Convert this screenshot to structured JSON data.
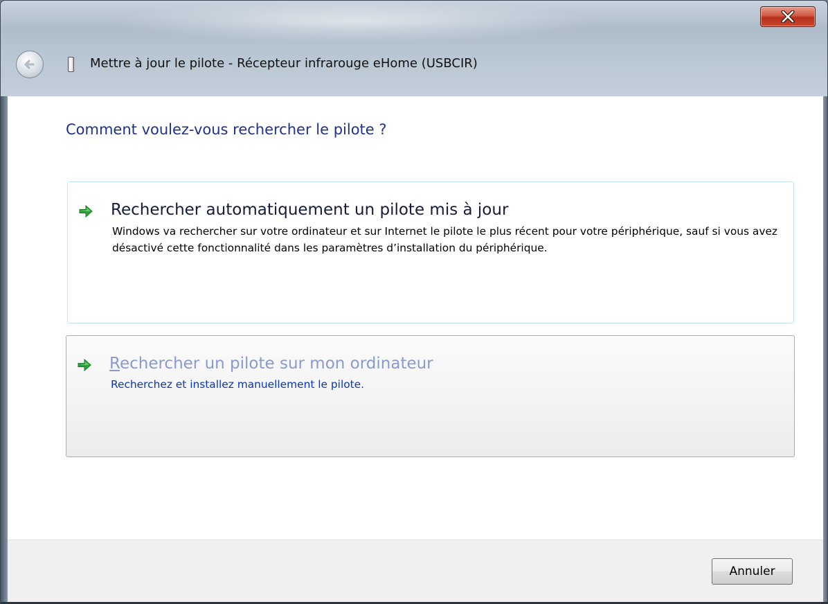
{
  "window": {
    "title": "Mettre à jour le pilote - Récepteur infrarouge eHome (USBCIR)",
    "close_label": "x"
  },
  "main": {
    "heading": "Comment voulez-vous rechercher le pilote ?",
    "options": [
      {
        "title": "Rechercher automatiquement un pilote mis à jour",
        "description": "Windows va rechercher sur votre ordinateur et sur Internet le pilote le plus récent pour votre périphérique, sauf si vous avez désactivé cette fonctionnalité dans les paramètres d’installation du périphérique.",
        "icon": "green-arrow-icon"
      },
      {
        "title_mnemonic": "R",
        "title_rest": "echercher un pilote sur mon ordinateur",
        "description": "Recherchez et installez manuellement le pilote.",
        "icon": "green-arrow-icon"
      }
    ]
  },
  "footer": {
    "cancel_label": "Annuler"
  },
  "colors": {
    "heading": "#1e3287",
    "link_hover": "#0a36b4",
    "arrow_green": "#2aa33a"
  }
}
